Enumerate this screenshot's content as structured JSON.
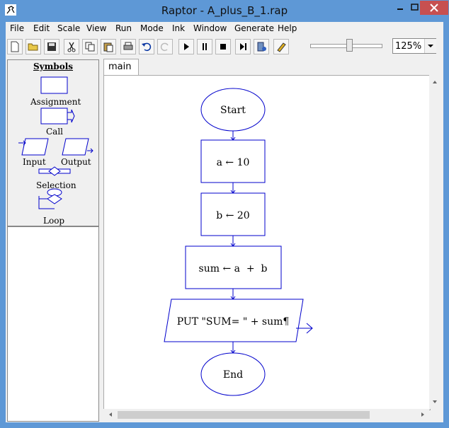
{
  "window": {
    "title": "Raptor - A_plus_B_1.rap"
  },
  "menu": [
    "File",
    "Edit",
    "Scale",
    "View",
    "Run",
    "Mode",
    "Ink",
    "Window",
    "Generate",
    "Help"
  ],
  "toolbar": {
    "zoom": "125%"
  },
  "palette": {
    "title": "Symbols",
    "items": [
      "Assignment",
      "Call",
      "Input",
      "Output",
      "Selection",
      "Loop"
    ]
  },
  "tabs": [
    "main"
  ],
  "flowchart": {
    "start": "Start",
    "assign1": "a ← 10",
    "assign2": "b ← 20",
    "assign3": "sum ← a  +  b",
    "output": "PUT \"SUM= \" + sum¶",
    "end": "End"
  },
  "colors": {
    "titlebar": "#5e98d6",
    "flow": "#0000cc"
  }
}
